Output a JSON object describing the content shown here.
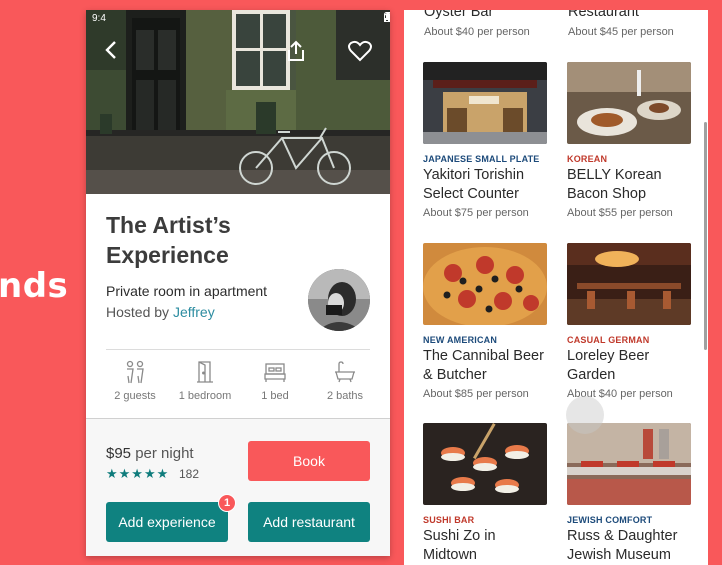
{
  "background": {
    "partial_text": "nds",
    "color": "#F9585A"
  },
  "listing": {
    "status_time": "9:4",
    "title": "The Artist’s Experience",
    "room_type": "Private room in apartment",
    "hosted_prefix": "Hosted by ",
    "host_name": "Jeffrey",
    "amenities": [
      {
        "icon": "guests-icon",
        "label": "2 guests"
      },
      {
        "icon": "door-icon",
        "label": "1 bedroom"
      },
      {
        "icon": "bed-icon",
        "label": "1 bed"
      },
      {
        "icon": "bathtub-icon",
        "label": "2 baths"
      }
    ],
    "price": "$95",
    "price_suffix": " per night",
    "stars": "★★★★★",
    "rating_value": 5,
    "review_count": "182",
    "book_label": "Book",
    "add_experience_label": "Add experience",
    "add_restaurant_label": "Add restaurant",
    "experience_badge": "1",
    "colors": {
      "accent": "#F9585A",
      "teal": "#0F8280",
      "link": "#2D8DA1"
    }
  },
  "restaurants": {
    "top_row": [
      {
        "name": "Oyster Bar",
        "price": "About $40 per person"
      },
      {
        "name": "Restaurant",
        "price": "About $45 per person"
      }
    ],
    "cards": [
      {
        "category": "JAPANESE SMALL PLATE",
        "name": "Yakitori Torishin Select Counter",
        "price": "About $75 per person"
      },
      {
        "category": "KOREAN",
        "name": "BELLY Korean Bacon Shop",
        "price": "About $55 per person"
      },
      {
        "category": "NEW AMERICAN",
        "name": "The Cannibal Beer & Butcher",
        "price": "About $85 per person"
      },
      {
        "category": "CASUAL GERMAN",
        "name": "Loreley Beer Garden",
        "price": "About $40 per person"
      },
      {
        "category": "SUSHI BAR",
        "name": "Sushi Zo in Midtown",
        "price": ""
      },
      {
        "category": "JEWISH COMFORT",
        "name": "Russ & Daughter Jewish Museum",
        "price": ""
      }
    ],
    "category_colors": {
      "blue": "#1C4A7A",
      "red": "#C0392B"
    }
  }
}
